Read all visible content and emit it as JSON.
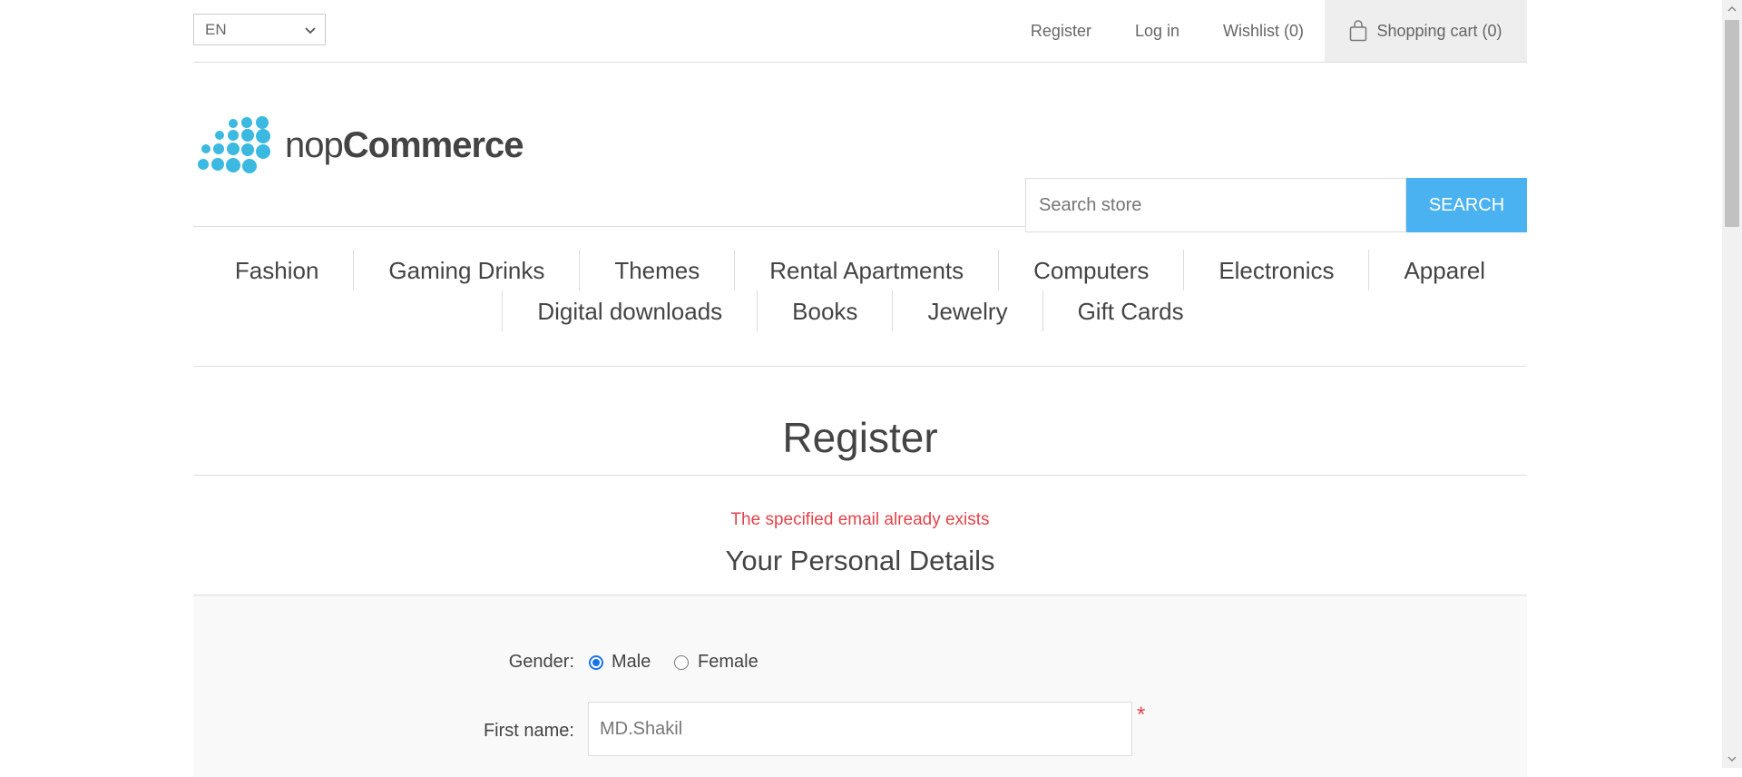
{
  "header": {
    "language": "EN",
    "links": {
      "register": "Register",
      "login": "Log in",
      "wishlist": "Wishlist (0)",
      "cart": "Shopping cart (0)"
    }
  },
  "logo": {
    "text_light": "nop",
    "text_bold": "Commerce",
    "brand_color": "#3cb9e0"
  },
  "search": {
    "placeholder": "Search store",
    "button": "Search"
  },
  "menu": {
    "row1": [
      "Fashion",
      "Gaming Drinks",
      "Themes",
      "Rental Apartments",
      "Computers",
      "Electronics",
      "Apparel"
    ],
    "row2": [
      "Digital downloads",
      "Books",
      "Jewelry",
      "Gift Cards"
    ]
  },
  "register": {
    "title": "Register",
    "error": "The specified email already exists",
    "section_title": "Your Personal Details",
    "gender_label": "Gender:",
    "gender_male": "Male",
    "gender_female": "Female",
    "gender_selected": "Male",
    "first_name_label": "First name:",
    "first_name_value": "MD.Shakil",
    "required_mark": "*"
  },
  "colors": {
    "accent": "#4ab2f1",
    "error": "#e4434b"
  }
}
